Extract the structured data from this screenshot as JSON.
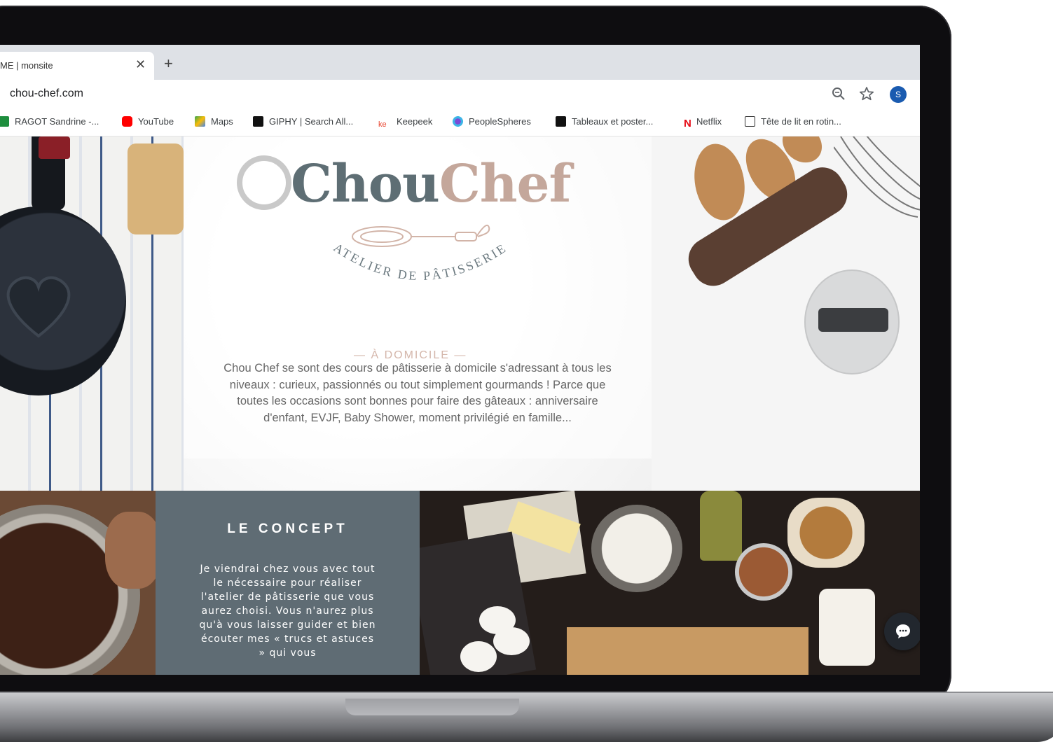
{
  "browser": {
    "tab_title": "ME | monsite",
    "tab_close": "✕",
    "new_tab": "+",
    "url": "chou-chef.com",
    "avatar_letter": "S",
    "bookmarks": [
      {
        "label": "RAGOT Sandrine -...",
        "icon": "sheets-icon",
        "color": "#1e8e3e"
      },
      {
        "label": "YouTube",
        "icon": "youtube-icon",
        "color": "#ff0000"
      },
      {
        "label": "Maps",
        "icon": "maps-icon",
        "color": "#34a853"
      },
      {
        "label": "GIPHY | Search All...",
        "icon": "giphy-icon",
        "color": "#111111"
      },
      {
        "label": "Keepeek",
        "icon": "keepeek-icon",
        "color": "#e8442f"
      },
      {
        "label": "PeopleSpheres",
        "icon": "peoplespheres-icon",
        "color": "#7b4bd6"
      },
      {
        "label": "Tableaux et poster...",
        "icon": "desenio-icon",
        "color": "#111111"
      },
      {
        "label": "Netflix",
        "icon": "netflix-icon",
        "color": "#e50914"
      },
      {
        "label": "Tête de lit en rotin...",
        "icon": "site-icon",
        "color": "#333333"
      }
    ]
  },
  "hero": {
    "logo_part1": "Chou",
    "logo_part2": "Chef",
    "tagline": "ATELIER DE PÂTISSERIE",
    "subtag": "— À DOMICILE —",
    "intro": "Chou Chef se sont des cours de pâtisserie à domicile s'adressant à tous les niveaux : curieux, passionnés ou tout simplement gourmands ! Parce que toutes les occasions sont bonnes pour faire des gâteaux : anniversaire d'enfant, EVJF, Baby Shower, moment privilégié en famille..."
  },
  "concept": {
    "title": "LE CONCEPT",
    "text": "Je viendrai chez vous avec tout le nécessaire pour réaliser l'atelier de pâtisserie que vous aurez choisi. Vous n'aurez plus qu'à vous laisser guider et bien écouter mes « trucs et astuces » qui vous"
  },
  "colors": {
    "accent_slate": "#5f6c74",
    "accent_rose": "#c4a79b"
  }
}
